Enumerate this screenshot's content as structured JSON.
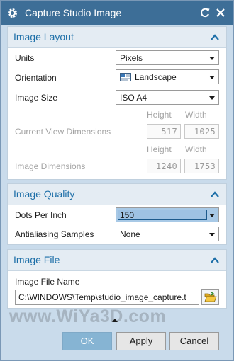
{
  "window": {
    "title": "Capture Studio Image",
    "icons": {
      "app": "gear-icon",
      "reset": "reset-icon",
      "close": "close-icon"
    }
  },
  "image_layout": {
    "heading": "Image Layout",
    "units": {
      "label": "Units",
      "value": "Pixels"
    },
    "orientation": {
      "label": "Orientation",
      "value": "Landscape",
      "icon": "landscape-page-icon"
    },
    "image_size": {
      "label": "Image Size",
      "value": "ISO A4"
    },
    "current_view": {
      "label": "Current View Dimensions",
      "height_head": "Height",
      "width_head": "Width",
      "height": "517",
      "width": "1025"
    },
    "image_dims": {
      "label": "Image Dimensions",
      "height_head": "Height",
      "width_head": "Width",
      "height": "1240",
      "width": "1753"
    }
  },
  "image_quality": {
    "heading": "Image Quality",
    "dpi": {
      "label": "Dots Per Inch",
      "value": "150"
    },
    "antialiasing": {
      "label": "Antialiasing Samples",
      "value": "None"
    }
  },
  "image_file": {
    "heading": "Image File",
    "name_label": "Image File Name",
    "path": "C:\\WINDOWS\\Temp\\studio_image_capture.t",
    "browse_icon": "folder-open-icon"
  },
  "watermark": "www.WiYa3D.com",
  "buttons": {
    "ok": "OK",
    "apply": "Apply",
    "cancel": "Cancel"
  },
  "colors": {
    "titlebar": "#3d6e97",
    "dialog_bg": "#c9dbeb",
    "section_heading": "#1d6fa8",
    "ok_button": "#86b4d3"
  }
}
